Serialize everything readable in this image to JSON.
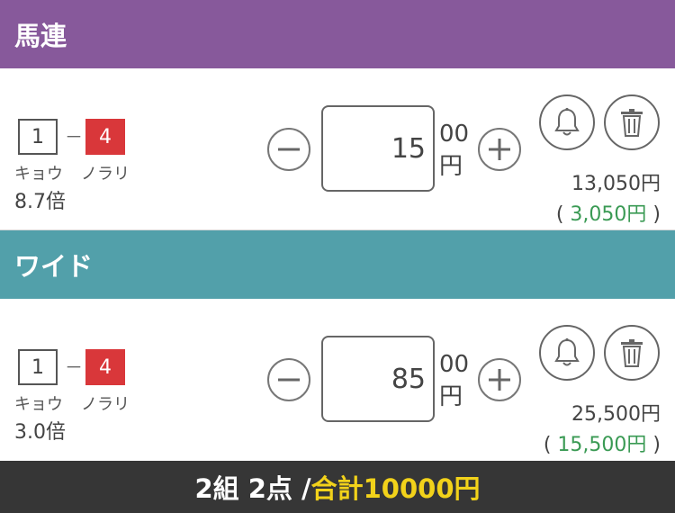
{
  "sections": [
    {
      "title": "馬連",
      "bet": {
        "horse_a": "1",
        "separator": "－",
        "horse_b": "4",
        "name_a": "キョウ",
        "name_b": "ノラリ",
        "odds": "8.7倍",
        "amount": "15",
        "unit_hundreds": "00",
        "unit_yen": "円",
        "payout": "13,050円",
        "profit_open": "(",
        "profit": "3,050円",
        "profit_close": ")"
      }
    },
    {
      "title": "ワイド",
      "bet": {
        "horse_a": "1",
        "separator": "－",
        "horse_b": "4",
        "name_a": "キョウ",
        "name_b": "ノラリ",
        "odds": "3.0倍",
        "amount": "85",
        "unit_hundreds": "00",
        "unit_yen": "円",
        "payout": "25,500円",
        "profit_open": "(",
        "profit": "15,500円",
        "profit_close": ")"
      }
    }
  ],
  "footer": {
    "summary": "2組 2点 /",
    "total": "合計10000円"
  },
  "icons": {
    "minus": "minus-icon",
    "plus": "plus-icon",
    "bell": "bell-icon",
    "trash": "trash-icon"
  },
  "colors": {
    "umaren_header": "#87599b",
    "wide_header": "#52a0aa",
    "horse_b_badge": "#d9373a",
    "profit": "#3a9a54",
    "footer_bg": "#363636",
    "footer_total": "#f2d21a"
  }
}
